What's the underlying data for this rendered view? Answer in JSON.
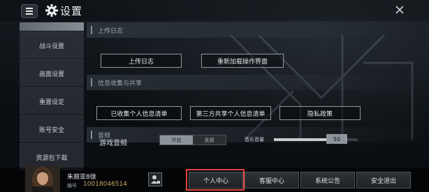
{
  "header": {
    "title": "设置",
    "menu_icon": "menu-icon",
    "settings_icon": "gear-icon",
    "close_icon": "close-icon"
  },
  "sidebar": {
    "items": [
      {
        "label": "战斗设置"
      },
      {
        "label": "画面设置"
      },
      {
        "label": "重置设定"
      },
      {
        "label": "账号安全"
      },
      {
        "label": "资源包下载"
      }
    ]
  },
  "sections": {
    "upload": {
      "title": "上传日志",
      "buttons": [
        "上传日志",
        "重新加载操作界面"
      ]
    },
    "privacy": {
      "title": "信息收集与共享",
      "buttons": [
        "已收集个人信息清单",
        "第三方共享个人信息清单",
        "隐私政策"
      ]
    },
    "audio": {
      "title": "音频",
      "game_audio_label": "游戏音频",
      "toggle_on": "开启",
      "toggle_off": "关闭",
      "music_volume_label": "音乐音量",
      "music_volume_value": "50",
      "music_volume_fraction": 0.5
    }
  },
  "player": {
    "name": "朱丽亚8徐",
    "id_label": "编号",
    "id_value": "10018046514"
  },
  "bottom_buttons": [
    "个人中心",
    "客服中心",
    "系统公告",
    "安全退出"
  ],
  "colors": {
    "highlight": "#e0453d",
    "id_value": "#c9a867"
  }
}
